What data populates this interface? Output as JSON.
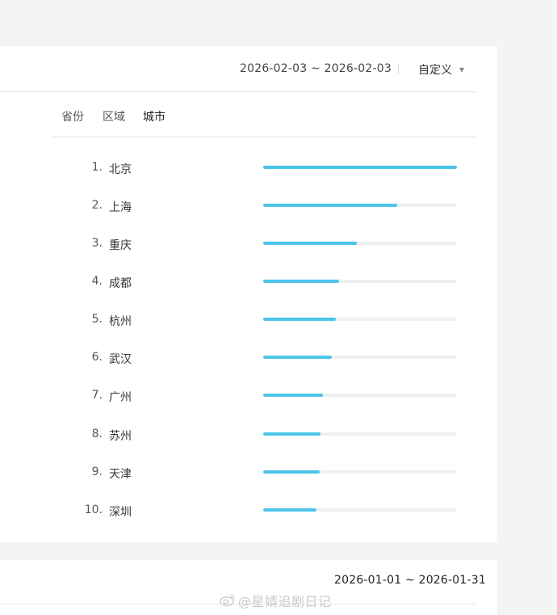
{
  "panel_top": {
    "date_range": "2026-02-03 ~ 2026-02-03",
    "mode_select": "自定义",
    "tabs": [
      "省份",
      "区域",
      "城市"
    ],
    "active_tab": "城市",
    "rankings": [
      {
        "rank": "1.",
        "city": "北京",
        "value": 1.0
      },
      {
        "rank": "2.",
        "city": "上海",
        "value": 0.69
      },
      {
        "rank": "3.",
        "city": "重庆",
        "value": 0.485
      },
      {
        "rank": "4.",
        "city": "成都",
        "value": 0.39
      },
      {
        "rank": "5.",
        "city": "杭州",
        "value": 0.375
      },
      {
        "rank": "6.",
        "city": "武汉",
        "value": 0.355
      },
      {
        "rank": "7.",
        "city": "广州",
        "value": 0.31
      },
      {
        "rank": "8.",
        "city": "苏州",
        "value": 0.295
      },
      {
        "rank": "9.",
        "city": "天津",
        "value": 0.29
      },
      {
        "rank": "10.",
        "city": "深圳",
        "value": 0.275
      }
    ]
  },
  "panel_bottom": {
    "date_range": "2026-01-01 ~ 2026-01-31"
  },
  "watermark": "@星婧追剧日记",
  "colors": {
    "bar_fill": "#4ac5e9",
    "bar_track": "#efefef",
    "page_bg": "#f4f4f4",
    "card_bg": "#ffffff"
  }
}
